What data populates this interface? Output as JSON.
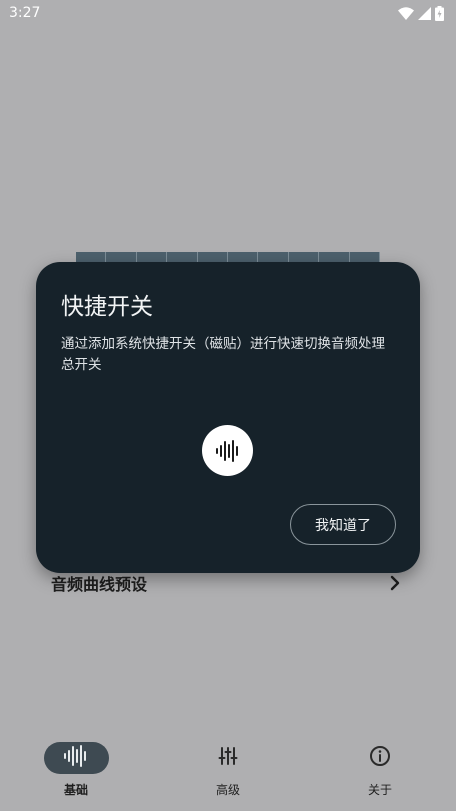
{
  "status_bar": {
    "time": "3:27",
    "icons": [
      "wifi-icon",
      "cellular-signal-icon",
      "battery-charging-icon"
    ]
  },
  "background": {
    "preset_row_label": "音频曲线预设",
    "preset_row_icon": "chevron-right-icon"
  },
  "dialog": {
    "title": "快捷开关",
    "body": "通过添加系统快捷开关（磁贴）进行快速切换音频处理总开关",
    "icon": "sound-wave-icon",
    "confirm_label": "我知道了"
  },
  "bottom_nav": {
    "items": [
      {
        "label": "基础",
        "icon": "sound-wave-icon",
        "selected": true
      },
      {
        "label": "高级",
        "icon": "sliders-icon",
        "selected": false
      },
      {
        "label": "关于",
        "icon": "info-icon",
        "selected": false
      }
    ]
  },
  "colors": {
    "scrim_background": "#afafb1",
    "dialog_background": "#16222a",
    "nav_selected_pill": "#3e4a52"
  }
}
